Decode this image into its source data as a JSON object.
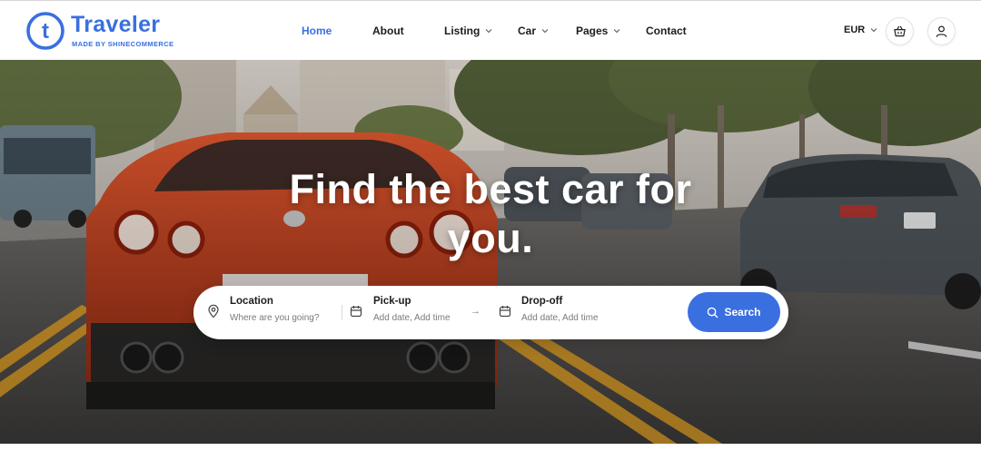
{
  "brand": {
    "name": "Traveler",
    "tagline": "MADE BY SHINECOMMERCE",
    "logo_letter": "t",
    "accent": "#3a6fe0"
  },
  "nav": {
    "items": [
      {
        "label": "Home",
        "active": true,
        "dropdown": false
      },
      {
        "label": "About",
        "active": false,
        "dropdown": false
      },
      {
        "label": "Listing",
        "active": false,
        "dropdown": true
      },
      {
        "label": "Car",
        "active": false,
        "dropdown": true
      },
      {
        "label": "Pages",
        "active": false,
        "dropdown": true
      },
      {
        "label": "Contact",
        "active": false,
        "dropdown": false
      }
    ],
    "currency": "EUR",
    "icons": [
      "basket-icon",
      "user-icon"
    ]
  },
  "hero": {
    "title_line1": "Find the best car for",
    "title_line2": "you."
  },
  "search": {
    "location": {
      "label": "Location",
      "placeholder": "Where are you going?",
      "icon": "map-pin-icon"
    },
    "pickup": {
      "label": "Pick-up",
      "placeholder": "Add date, Add time",
      "icon": "calendar-icon"
    },
    "dropoff": {
      "label": "Drop-off",
      "placeholder": "Add date, Add time",
      "icon": "calendar-icon"
    },
    "arrow": "→",
    "button_label": "Search",
    "button_icon": "search-icon"
  }
}
